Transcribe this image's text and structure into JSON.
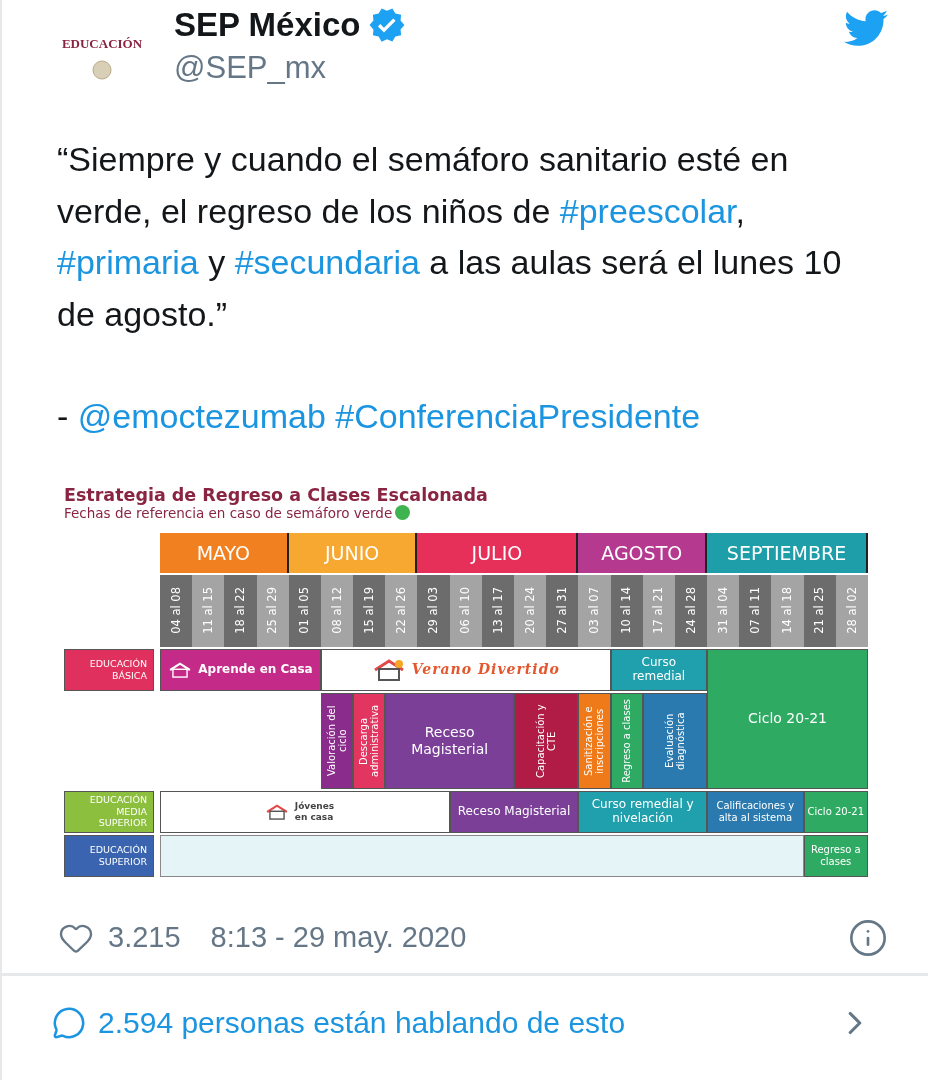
{
  "tweet": {
    "logo_text": "EDUCACIÓN",
    "author": "SEP México",
    "verified": true,
    "handle": "@SEP_mx",
    "paragraphs": [
      [
        {
          "kind": "text",
          "text": "“Siempre y cuando el semáforo sanitario esté en verde, el regreso de los niños de "
        },
        {
          "kind": "link",
          "text": "#preescolar"
        },
        {
          "kind": "text",
          "text": ", "
        },
        {
          "kind": "link",
          "text": "#primaria"
        },
        {
          "kind": "text",
          "text": " y "
        },
        {
          "kind": "link",
          "text": "#secundaria"
        },
        {
          "kind": "text",
          "text": " a las aulas será el lunes 10 de agosto.”"
        }
      ],
      [
        {
          "kind": "text",
          "text": "- "
        },
        {
          "kind": "link",
          "text": "@emoctezumab"
        },
        {
          "kind": "link",
          "text": "#ConferenciaPresidente"
        }
      ]
    ]
  },
  "infographic": {
    "title": "Estrategia de Regreso a Clases Escalonada",
    "subtitle": "Fechas de referencia en caso de semáforo verde",
    "months": [
      {
        "label": "MAYO",
        "color": "#f08020",
        "weeks": [
          "04 al 08",
          "11 al 15",
          "18 al 22",
          "25 al 29"
        ]
      },
      {
        "label": "JUNIO",
        "color": "#f7a830",
        "weeks": [
          "01 al 05",
          "08 al 12",
          "15 al 19",
          "22 al 26"
        ]
      },
      {
        "label": "JULIO",
        "color": "#e6305a",
        "weeks": [
          "29 al 03",
          "06 al 10",
          "13 al 17",
          "20 al 24",
          "27 al 31"
        ]
      },
      {
        "label": "AGOSTO",
        "color": "#b4398f",
        "weeks": [
          "03 al 07",
          "10 al 14",
          "17 al 21",
          "24 al 28"
        ]
      },
      {
        "label": "SEPTIEMBRE",
        "color": "#1d9ea8",
        "weeks": [
          "31 al 04",
          "07 al 11",
          "14 al 18",
          "21 al 25",
          "28 al 02"
        ]
      }
    ],
    "rows": [
      {
        "label": "EDUCACIÓN BÁSICA",
        "color": "#e0305e",
        "blocks": [
          {
            "kind": "icon",
            "text": "Aprende en Casa",
            "color": "#c42a87"
          },
          {
            "kind": "icon",
            "text": "Verano Divertido",
            "color": "#ffffff"
          },
          {
            "kind": "plain",
            "text": "Curso remedial",
            "color": "#1fa0ac"
          },
          {
            "kind": "plain",
            "text": "Ciclo 20-21",
            "color": "#2eaa63"
          },
          {
            "kind": "vertical",
            "text": "Valoración del ciclo",
            "color": "#8a2c8c"
          },
          {
            "kind": "vertical",
            "text": "Descarga administrativa",
            "color": "#e23560"
          },
          {
            "kind": "plain",
            "text": "Receso Magisterial",
            "color": "#7b3f98"
          },
          {
            "kind": "vertical",
            "text": "Capacitación y CTE",
            "color": "#b01c45"
          },
          {
            "kind": "vertical",
            "text": "Sanitización e inscripciones",
            "color": "#ef7a1a"
          },
          {
            "kind": "vertical",
            "text": "Regreso a clases",
            "color": "#2eaa63"
          },
          {
            "kind": "vertical",
            "text": "Evaluación diagnóstica",
            "color": "#2a7ab0"
          }
        ]
      },
      {
        "label": "EDUCACIÓN MEDIA SUPERIOR",
        "color": "#8dbf3e",
        "blocks": [
          {
            "kind": "icon",
            "text": "Jóvenes en casa",
            "color": "#ffffff"
          },
          {
            "kind": "plain",
            "text": "Receso Magisterial",
            "color": "#7b3f98"
          },
          {
            "kind": "plain",
            "text": "Curso remedial y nivelación",
            "color": "#1fa0ac"
          },
          {
            "kind": "plain",
            "text": "Calificaciones y alta al sistema",
            "color": "#2a7ab0"
          },
          {
            "kind": "plain",
            "text": "Ciclo 20-21",
            "color": "#2eaa63"
          }
        ]
      },
      {
        "label": "EDUCACIÓN SUPERIOR",
        "color": "#3a64b0",
        "blocks": [
          {
            "kind": "plain",
            "text": "Regreso a clases",
            "color": "#2eaa63"
          }
        ]
      }
    ]
  },
  "footer": {
    "likes": "3.215",
    "timestamp": "8:13 - 29 may. 2020",
    "conversation": "2.594 personas están hablando de esto"
  }
}
